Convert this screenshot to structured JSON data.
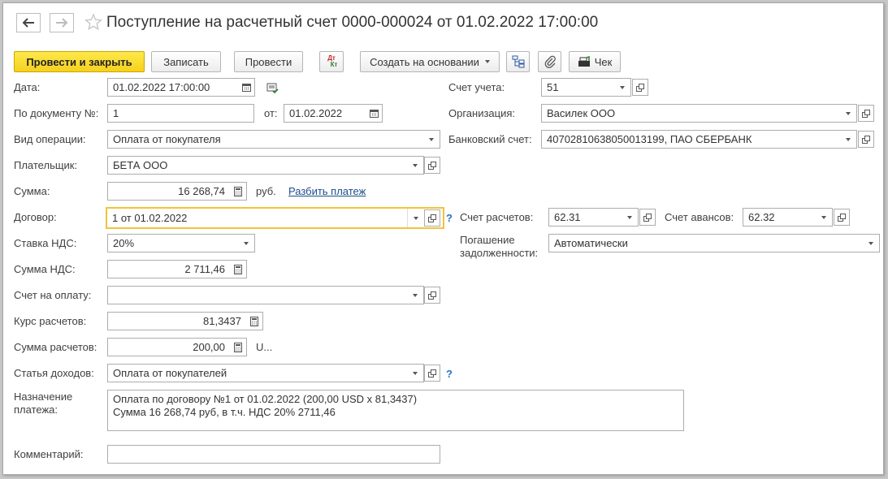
{
  "header": {
    "title": "Поступление на расчетный счет 0000-000024 от 01.02.2022 17:00:00"
  },
  "toolbar": {
    "post_close": "Провести и закрыть",
    "save": "Записать",
    "post": "Провести",
    "dt_kt": "Дт\nКт",
    "create_based": "Создать на основании",
    "check": "Чек"
  },
  "form": {
    "date": {
      "label": "Дата:",
      "value": "01.02.2022 17:00:00"
    },
    "doc_num": {
      "label": "По документу №:",
      "value": "1"
    },
    "doc_from": {
      "label": "от:",
      "value": "01.02.2022"
    },
    "operation": {
      "label": "Вид операции:",
      "value": "Оплата от покупателя"
    },
    "payer": {
      "label": "Плательщик:",
      "value": "БЕТА ООО"
    },
    "amount": {
      "label": "Сумма:",
      "value": "16 268,74",
      "currency": "руб."
    },
    "split_payment": "Разбить платеж",
    "contract": {
      "label": "Договор:",
      "value": "1 от 01.02.2022"
    },
    "vat_rate": {
      "label": "Ставка НДС:",
      "value": "20%"
    },
    "vat_amount": {
      "label": "Сумма НДС:",
      "value": "2 711,46"
    },
    "invoice": {
      "label": "Счет на оплату:",
      "value": ""
    },
    "rate": {
      "label": "Курс расчетов:",
      "value": "81,3437"
    },
    "settle_amount": {
      "label": "Сумма расчетов:",
      "value": "200,00",
      "currency": "U..."
    },
    "income_item": {
      "label": "Статья доходов:",
      "value": "Оплата от покупателей"
    },
    "purpose": {
      "label_line1": "Назначение",
      "label_line2": "платежа:",
      "line1": "Оплата по договору №1 от 01.02.2022 (200,00 USD x 81,3437)",
      "line2": "Сумма 16 268,74 руб, в т.ч. НДС 20% 2711,46"
    },
    "comment": {
      "label": "Комментарий:",
      "value": ""
    },
    "account": {
      "label": "Счет учета:",
      "value": "51"
    },
    "organization": {
      "label": "Организация:",
      "value": "Василек ООО"
    },
    "bank_account": {
      "label": "Банковский счет:",
      "value": "40702810638050013199, ПАО СБЕРБАНК"
    },
    "settle_account": {
      "label": "Счет расчетов:",
      "value": "62.31"
    },
    "advance_account": {
      "label": "Счет авансов:",
      "value": "62.32"
    },
    "debt_repay": {
      "label_line1": "Погашение",
      "label_line2": "задолженности:",
      "value": "Автоматически"
    },
    "help_mark": "?"
  }
}
